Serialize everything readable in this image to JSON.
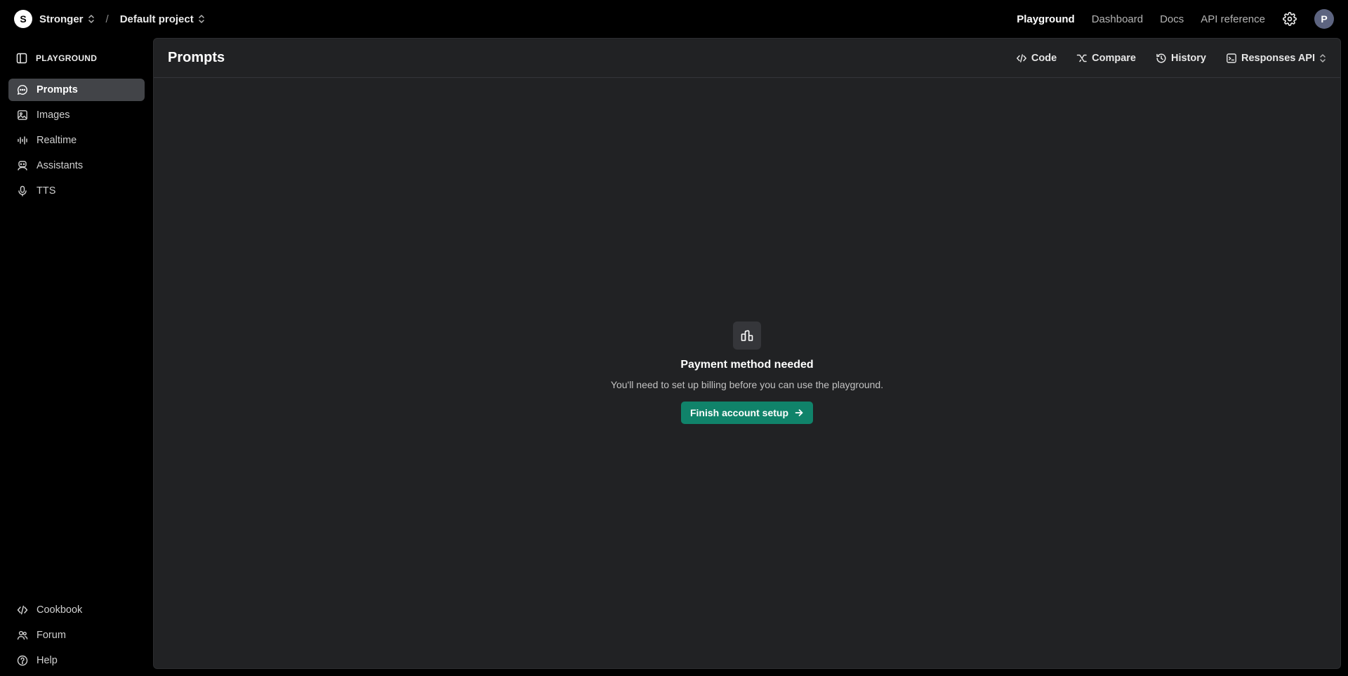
{
  "topbar": {
    "org_initial": "S",
    "org_name": "Stronger",
    "separator": "/",
    "project_name": "Default project",
    "nav": [
      {
        "label": "Playground",
        "active": true
      },
      {
        "label": "Dashboard",
        "active": false
      },
      {
        "label": "Docs",
        "active": false
      },
      {
        "label": "API reference",
        "active": false
      }
    ],
    "settings_icon": "gear-icon",
    "user_initial": "P"
  },
  "sidebar": {
    "header": "PLAYGROUND",
    "header_icon": "sidebar-toggle-icon",
    "items": [
      {
        "label": "Prompts",
        "icon": "chat-bubble-icon",
        "active": true
      },
      {
        "label": "Images",
        "icon": "image-icon",
        "active": false
      },
      {
        "label": "Realtime",
        "icon": "audio-wave-icon",
        "active": false
      },
      {
        "label": "Assistants",
        "icon": "robot-icon",
        "active": false
      },
      {
        "label": "TTS",
        "icon": "microphone-icon",
        "active": false
      }
    ],
    "bottom_items": [
      {
        "label": "Cookbook",
        "icon": "code-icon"
      },
      {
        "label": "Forum",
        "icon": "people-icon"
      },
      {
        "label": "Help",
        "icon": "help-icon"
      }
    ]
  },
  "main": {
    "title": "Prompts",
    "actions": [
      {
        "label": "Code",
        "icon": "code-icon"
      },
      {
        "label": "Compare",
        "icon": "compare-icon"
      },
      {
        "label": "History",
        "icon": "history-icon"
      },
      {
        "label": "Responses API",
        "icon": "terminal-icon"
      }
    ]
  },
  "empty_state": {
    "icon": "bank-icon",
    "title": "Payment method needed",
    "description": "You'll need to set up billing before you can use the playground.",
    "button_label": "Finish account setup"
  },
  "colors": {
    "background": "#000000",
    "panel": "#212224",
    "active_item": "#424448",
    "accent_green": "#10836a"
  }
}
